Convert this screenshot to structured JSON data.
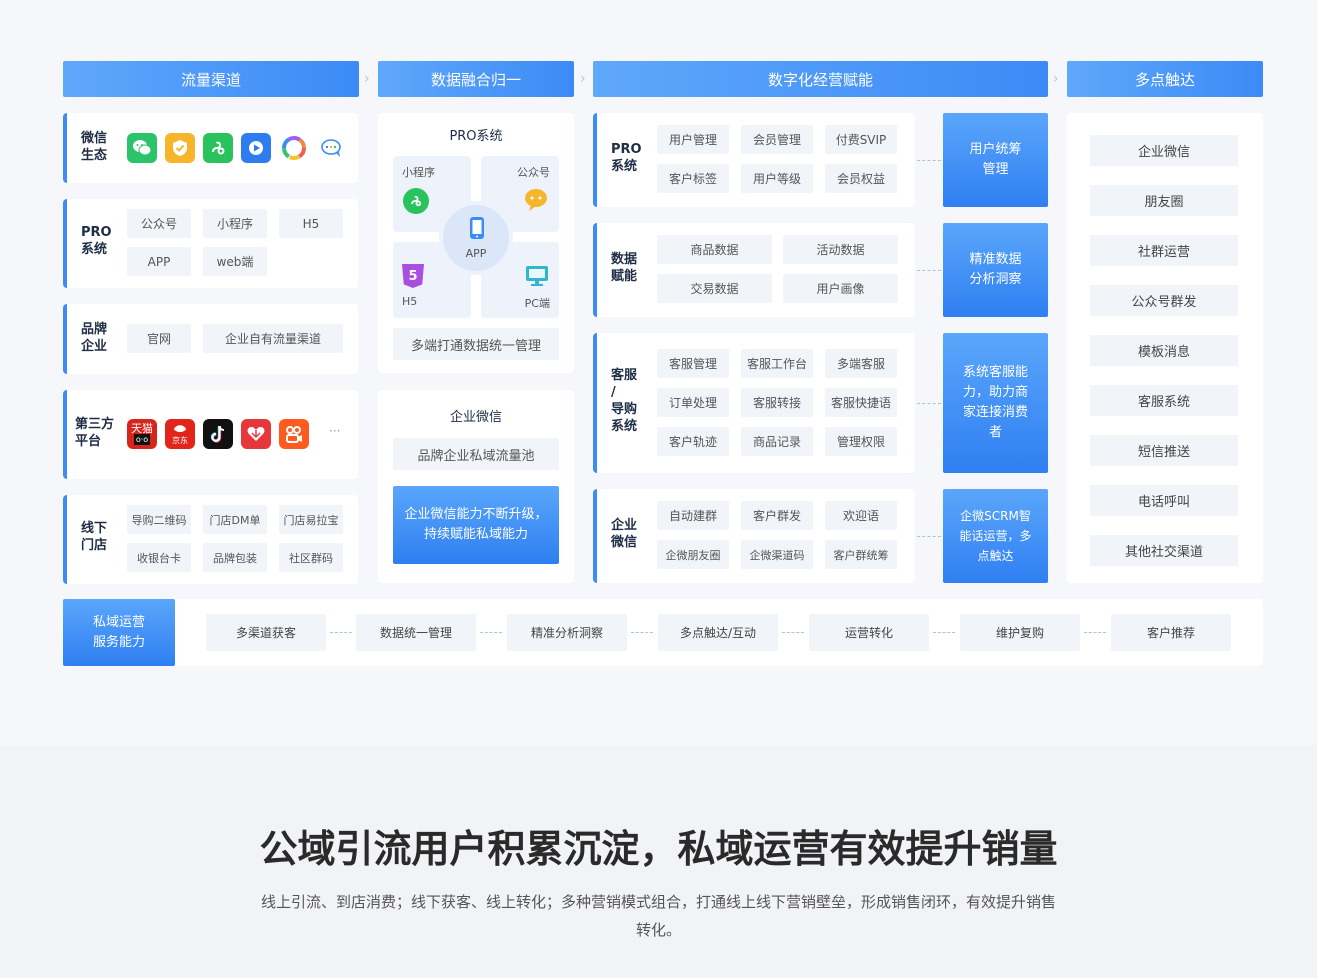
{
  "headers": {
    "traffic": "流量渠道",
    "data_merge": "数据融合归一",
    "digital": "数字化经营赋能",
    "multi_reach": "多点触达"
  },
  "left": {
    "wechat": {
      "title": "微信\n生态",
      "icons": [
        "wechat-icon",
        "wechat-pay-icon",
        "mini-program-icon",
        "video-channel-icon",
        "colorful-circle-icon",
        "wechat-chat-icon"
      ]
    },
    "pro": {
      "title": "PRO\n系统",
      "tags": [
        "公众号",
        "小程序",
        "H5",
        "APP",
        "web端"
      ]
    },
    "brand": {
      "title": "品牌\n企业",
      "tags": [
        "官网",
        "企业自有流量渠道"
      ]
    },
    "third": {
      "title": "第三方\n平台",
      "icons": [
        "tmall-icon",
        "jd-icon",
        "douyin-icon",
        "xiaohongshu-icon",
        "kuaishou-icon"
      ],
      "tmall": "天猫",
      "jd": "京东",
      "more": "···"
    },
    "offline": {
      "title": "线下\n门店",
      "tags": [
        "导购二维码",
        "门店DM单",
        "门店易拉宝",
        "收银台卡",
        "品牌包装",
        "社区群码"
      ]
    }
  },
  "middle": {
    "pro_title": "PRO系统",
    "mini": "小程序",
    "gzh": "公众号",
    "h5": "H5",
    "pc": "PC端",
    "app": "APP",
    "h5_badge": "5",
    "unified": "多端打通数据统一管理",
    "qw_title": "企业微信",
    "qw_pool": "品牌企业私域流量池",
    "qw_ability": "企业微信能力不断升级，持续赋能私域能力"
  },
  "digital": {
    "pro": {
      "title": "PRO\n系统",
      "tags": [
        "用户管理",
        "会员管理",
        "付费SVIP",
        "客户标签",
        "用户等级",
        "会员权益"
      ],
      "box": "用户统筹\n管理"
    },
    "data": {
      "title": "数据\n赋能",
      "tags": [
        "商品数据",
        "活动数据",
        "交易数据",
        "用户画像"
      ],
      "box": "精准数据\n分析洞察"
    },
    "service": {
      "title": "客服\n/\n导购\n系统",
      "tags": [
        "客服管理",
        "客服工作台",
        "多端客服",
        "订单处理",
        "客服转接",
        "客服快捷语",
        "客户轨迹",
        "商品记录",
        "管理权限"
      ],
      "box": "系统客服能\n力，助力商\n家连接消费\n者"
    },
    "qw": {
      "title": "企业\n微信",
      "tags": [
        "自动建群",
        "客户群发",
        "欢迎语",
        "企微朋友圈",
        "企微渠道码",
        "客户群统筹"
      ],
      "box": "企微SCRM智\n能话运营，多\n点触达"
    }
  },
  "reach": [
    "企业微信",
    "朋友圈",
    "社群运营",
    "公众号群发",
    "模板消息",
    "客服系统",
    "短信推送",
    "电话呼叫",
    "其他社交渠道"
  ],
  "flow": {
    "label": "私域运营\n服务能力",
    "steps": [
      "多渠道获客",
      "数据统一管理",
      "精准分析洞察",
      "多点触达/互动",
      "运营转化",
      "维护复购",
      "客户推荐"
    ]
  },
  "bottom": {
    "headline": "公域引流用户积累沉淀，私域运营有效提升销量",
    "desc_line1": "线上引流、到店消费；线下获客、线上转化；多种营销模式组合，打通线上线下营销壁垒，形成销售闭环，有效提升销售",
    "desc_line2": "转化。"
  }
}
